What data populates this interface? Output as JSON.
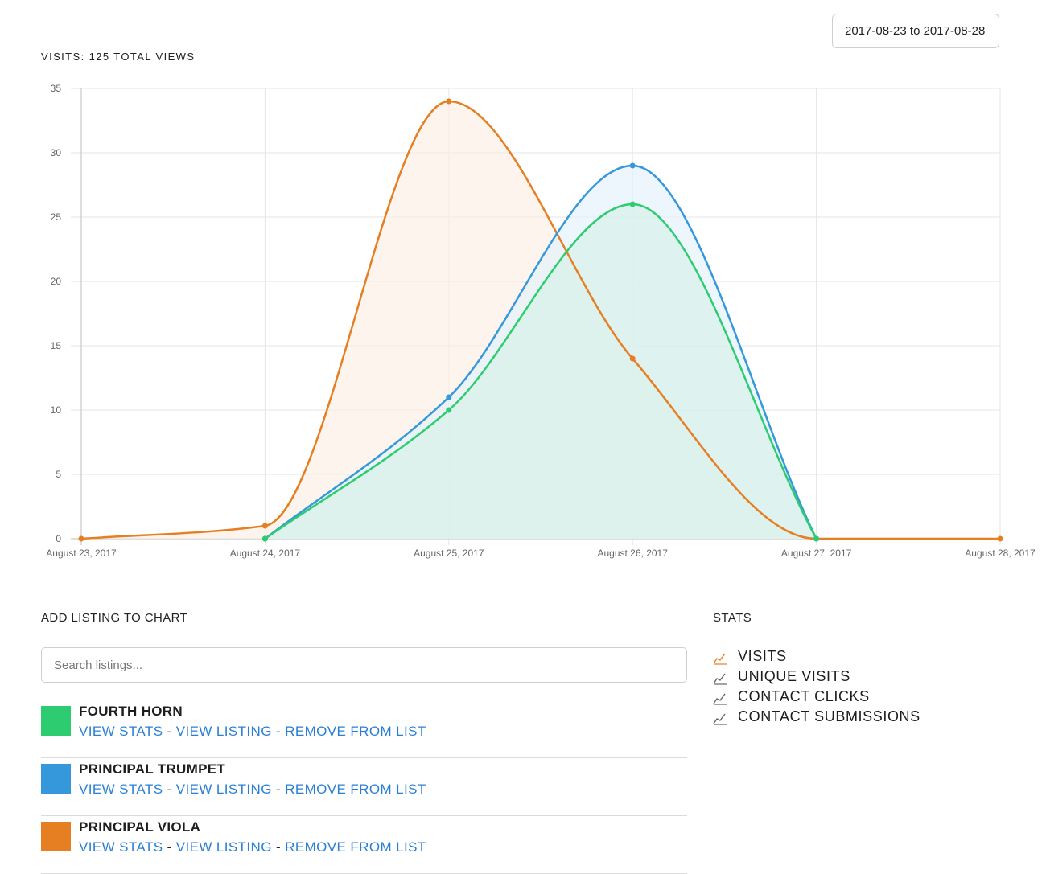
{
  "date_range": {
    "value": "2017-08-23 to 2017-08-28"
  },
  "chart_header": {
    "title": "VISITS: 125 TOTAL VIEWS"
  },
  "chart_data": {
    "type": "area",
    "title": "VISITS: 125 TOTAL VIEWS",
    "xlabel": "",
    "ylabel": "",
    "x": [
      "August 23, 2017",
      "August 24, 2017",
      "August 25, 2017",
      "August 26, 2017",
      "August 27, 2017",
      "August 28, 2017"
    ],
    "ylim": [
      0,
      35
    ],
    "yticks": [
      0,
      5,
      10,
      15,
      20,
      25,
      30,
      35
    ],
    "grid": true,
    "series": [
      {
        "name": "PRINCIPAL VIOLA",
        "color": "#e67e22",
        "fill": "#fcefe3",
        "values": [
          0,
          1,
          34,
          14,
          0,
          0
        ]
      },
      {
        "name": "PRINCIPAL TRUMPET",
        "color": "#3498db",
        "fill": "#e3f1fb",
        "values": [
          null,
          0,
          11,
          29,
          0,
          null
        ]
      },
      {
        "name": "FOURTH HORN",
        "color": "#2ecc71",
        "fill": "#d5efe8",
        "values": [
          null,
          0,
          10,
          26,
          0,
          null
        ]
      }
    ]
  },
  "add_listing": {
    "title": "ADD LISTING TO CHART",
    "search_placeholder": "Search listings..."
  },
  "listings": [
    {
      "name": "FOURTH HORN",
      "color": "#2ecc71",
      "view_stats": "VIEW STATS",
      "view_listing": "VIEW LISTING",
      "remove": "REMOVE FROM LIST",
      "sep1": " - ",
      "sep2": " - "
    },
    {
      "name": "PRINCIPAL TRUMPET",
      "color": "#3498db",
      "view_stats": "VIEW STATS",
      "view_listing": "VIEW LISTING",
      "remove": "REMOVE FROM LIST",
      "sep1": " - ",
      "sep2": " - "
    },
    {
      "name": "PRINCIPAL VIOLA",
      "color": "#e67e22",
      "view_stats": "VIEW STATS",
      "view_listing": "VIEW LISTING",
      "remove": "REMOVE FROM LIST",
      "sep1": " - ",
      "sep2": " - "
    }
  ],
  "stats": {
    "title": "STATS",
    "items": [
      {
        "label": "VISITS",
        "icon": "line-chart-icon",
        "active": true,
        "color": "#e67e22"
      },
      {
        "label": "UNIQUE VISITS",
        "icon": "line-chart-icon",
        "active": false,
        "color": "#666666"
      },
      {
        "label": "CONTACT CLICKS",
        "icon": "line-chart-icon",
        "active": false,
        "color": "#666666"
      },
      {
        "label": "CONTACT SUBMISSIONS",
        "icon": "line-chart-icon",
        "active": false,
        "color": "#666666"
      }
    ]
  }
}
